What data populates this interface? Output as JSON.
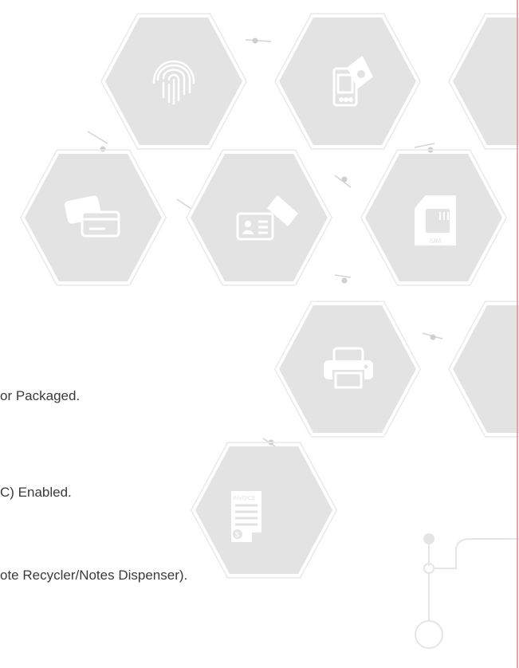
{
  "colors": {
    "hex_fill": "#e3e3e3",
    "hex_outline": "#eaeaea",
    "icon": "#ffffff",
    "connector": "#d4d4d4",
    "accent_rule": "#e8a0a4",
    "text": "#3a3a3a"
  },
  "features": [
    {
      "text": "or Packaged."
    },
    {
      "text": "C) Enabled."
    },
    {
      "text": "ote Recycler/Notes Dispenser)."
    }
  ],
  "icons": [
    "fingerprint-icon",
    "mobile-payment-icon",
    "card-icon",
    "id-card-icon",
    "sim-card-icon",
    "printer-icon",
    "invoice-icon"
  ],
  "labels": {
    "sim": "SIM",
    "invoice": "INVOICE",
    "currency": "$"
  }
}
